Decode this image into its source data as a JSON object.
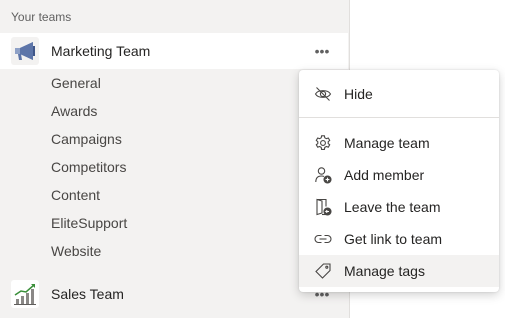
{
  "sidebar": {
    "section_header": "Your teams",
    "teams": [
      {
        "name": "Marketing Team",
        "more": "•••",
        "channels": [
          "General",
          "Awards",
          "Campaigns",
          "Competitors",
          "Content",
          "EliteSupport",
          "Website"
        ]
      },
      {
        "name": "Sales Team",
        "more": "•••"
      }
    ]
  },
  "context_menu": {
    "items": [
      {
        "label": "Hide",
        "icon": "eye-off-icon"
      },
      {
        "label": "Manage team",
        "icon": "gear-icon"
      },
      {
        "label": "Add member",
        "icon": "add-person-icon"
      },
      {
        "label": "Leave the team",
        "icon": "leave-door-icon"
      },
      {
        "label": "Get link to team",
        "icon": "link-icon"
      },
      {
        "label": "Manage tags",
        "icon": "tag-icon"
      }
    ]
  },
  "colors": {
    "sidebar_bg": "#f3f2f1",
    "text": "#252423",
    "muted": "#616161",
    "menu_hover": "#f3f2f1"
  }
}
